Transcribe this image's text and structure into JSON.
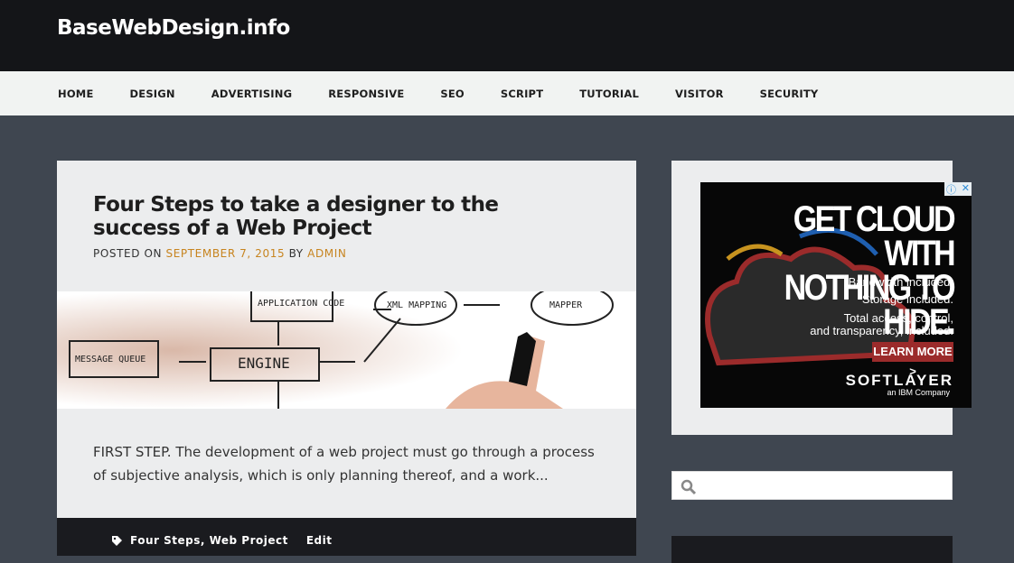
{
  "site": {
    "title": "BaseWebDesign.info"
  },
  "nav": [
    "HOME",
    "DESIGN",
    "ADVERTISING",
    "RESPONSIVE",
    "SEO",
    "SCRIPT",
    "TUTORIAL",
    "VISITOR",
    "SECURITY"
  ],
  "post": {
    "title": "Four Steps to take a designer to the success of a Web Project",
    "posted_on": "POSTED ON",
    "date": "SEPTEMBER 7, 2015",
    "by": "BY",
    "author": "ADMIN",
    "image_labels": [
      "APPLICATION CODE",
      "XML MAPPING",
      "MAPPER",
      "MESSAGE QUEUE",
      "ENGINE"
    ],
    "excerpt": "FIRST STEP. The development of a web project must go through a process of subjective analysis, which is only planning thereof, and a work...",
    "tags": "Four Steps, Web Project",
    "edit": "Edit"
  },
  "ad": {
    "headline1": "GET CLOUD WITH",
    "headline2": "NOTHING TO HIDE.",
    "line1": "Bandwidth included.",
    "line2": "Storage included.",
    "line3": "Total access, control,",
    "line4": "and transparency, included.",
    "cta": "LEARN MORE >",
    "brand": "SOFTLAYER",
    "brand_sub": "an IBM Company"
  },
  "search": {
    "placeholder": ""
  },
  "colors": {
    "accent": "#c7841f",
    "header": "#141518",
    "background": "#3f4650"
  }
}
